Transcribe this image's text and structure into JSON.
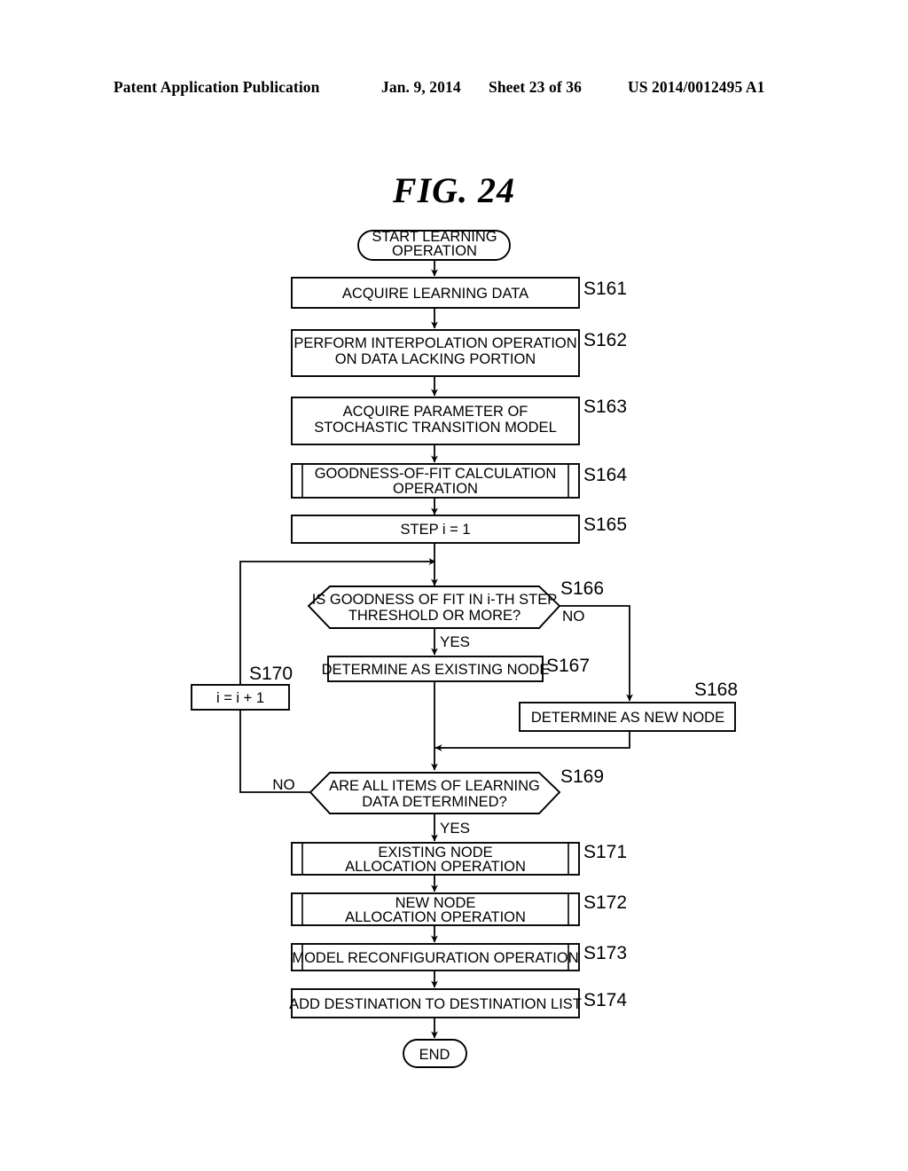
{
  "header": {
    "publication": "Patent Application Publication",
    "date": "Jan. 9, 2014",
    "sheet": "Sheet 23 of 36",
    "patent_number": "US 2014/0012495 A1"
  },
  "figure": {
    "title": "FIG. 24"
  },
  "flowchart": {
    "nodes": {
      "start": {
        "label": "START LEARNING\nOPERATION",
        "line1": "START LEARNING",
        "line2": "OPERATION",
        "type": "terminator"
      },
      "s161": {
        "step": "S161",
        "line1": "ACQUIRE LEARNING DATA",
        "line2": "",
        "type": "process"
      },
      "s162": {
        "step": "S162",
        "line1": "PERFORM INTERPOLATION OPERATION",
        "line2": "ON DATA LACKING PORTION",
        "type": "process"
      },
      "s163": {
        "step": "S163",
        "line1": "ACQUIRE PARAMETER OF",
        "line2": "STOCHASTIC TRANSITION MODEL",
        "type": "process"
      },
      "s164": {
        "step": "S164",
        "line1": "GOODNESS-OF-FIT CALCULATION",
        "line2": "OPERATION",
        "type": "predefined-process"
      },
      "s165": {
        "step": "S165",
        "line1": "STEP i = 1",
        "line2": "",
        "type": "process"
      },
      "s166": {
        "step": "S166",
        "line1": "IS GOODNESS OF FIT IN i-TH STEP",
        "line2": "THRESHOLD OR MORE?",
        "type": "decision",
        "branch_yes": "YES",
        "branch_no": "NO"
      },
      "s167": {
        "step": "S167",
        "line1": "DETERMINE AS EXISTING NODE",
        "line2": "",
        "type": "process"
      },
      "s168": {
        "step": "S168",
        "line1": "DETERMINE AS NEW NODE",
        "line2": "",
        "type": "process"
      },
      "s169": {
        "step": "S169",
        "line1": "ARE ALL ITEMS OF LEARNING",
        "line2": "DATA DETERMINED?",
        "type": "decision",
        "branch_yes": "YES",
        "branch_no": "NO"
      },
      "s170": {
        "step": "S170",
        "line1": "i = i + 1",
        "line2": "",
        "type": "process"
      },
      "s171": {
        "step": "S171",
        "line1": "EXISTING NODE",
        "line2": "ALLOCATION OPERATION",
        "type": "predefined-process"
      },
      "s172": {
        "step": "S172",
        "line1": "NEW NODE",
        "line2": "ALLOCATION OPERATION",
        "type": "predefined-process"
      },
      "s173": {
        "step": "S173",
        "line1": "MODEL RECONFIGURATION OPERATION",
        "line2": "",
        "type": "predefined-process"
      },
      "s174": {
        "step": "S174",
        "line1": "ADD DESTINATION TO DESTINATION LIST",
        "line2": "",
        "type": "process"
      },
      "end": {
        "line1": "END",
        "line2": "",
        "type": "terminator"
      }
    }
  },
  "colors": {
    "ink": "#000000",
    "paper": "#ffffff"
  }
}
